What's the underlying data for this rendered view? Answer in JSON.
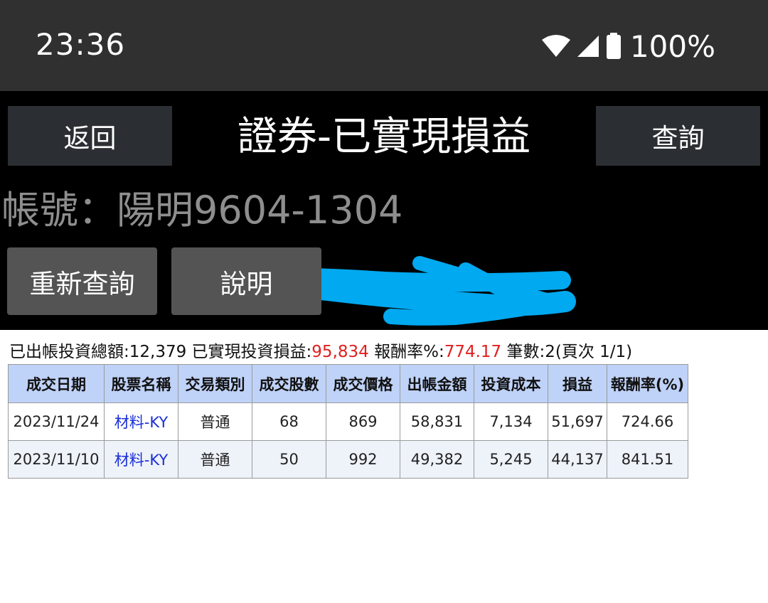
{
  "status_bar": {
    "time": "23:36",
    "battery_percent": "100%",
    "icons": [
      "wifi-icon",
      "signal-icon",
      "battery-icon"
    ]
  },
  "header": {
    "back_label": "返回",
    "title": "證券-已實現損益",
    "query_label": "查詢"
  },
  "account": {
    "text": "帳號：陽明9604-1304"
  },
  "actions": {
    "requery_label": "重新查詢",
    "help_label": "說明"
  },
  "summary": {
    "total_invest_label": "已出帳投資總額:",
    "total_invest_value": "12,379",
    "realized_label": "已實現投資損益:",
    "realized_value": "95,834",
    "return_label": "報酬率%:",
    "return_value": "774.17",
    "count_text": "筆數:2(頁次 1/1)"
  },
  "table": {
    "columns": [
      "成交日期",
      "股票名稱",
      "交易類別",
      "成交股數",
      "成交價格",
      "出帳金額",
      "投資成本",
      "損益",
      "報酬率(%)"
    ],
    "rows": [
      [
        "2023/11/24",
        "材料-KY",
        "普通",
        "68",
        "869",
        "58,831",
        "7,134",
        "51,697",
        "724.66"
      ],
      [
        "2023/11/10",
        "材料-KY",
        "普通",
        "50",
        "992",
        "49,382",
        "5,245",
        "44,137",
        "841.51"
      ]
    ]
  },
  "colors": {
    "status_bar_bg": "#303030",
    "header_bg": "#000000",
    "header_button_bg": "#2b2f33",
    "action_button_bg": "#545454",
    "table_header_bg": "#bfd2f8",
    "highlight_red": "#e02020",
    "link_blue": "#1a2fd6",
    "redaction_scribble": "#00a9f0"
  }
}
